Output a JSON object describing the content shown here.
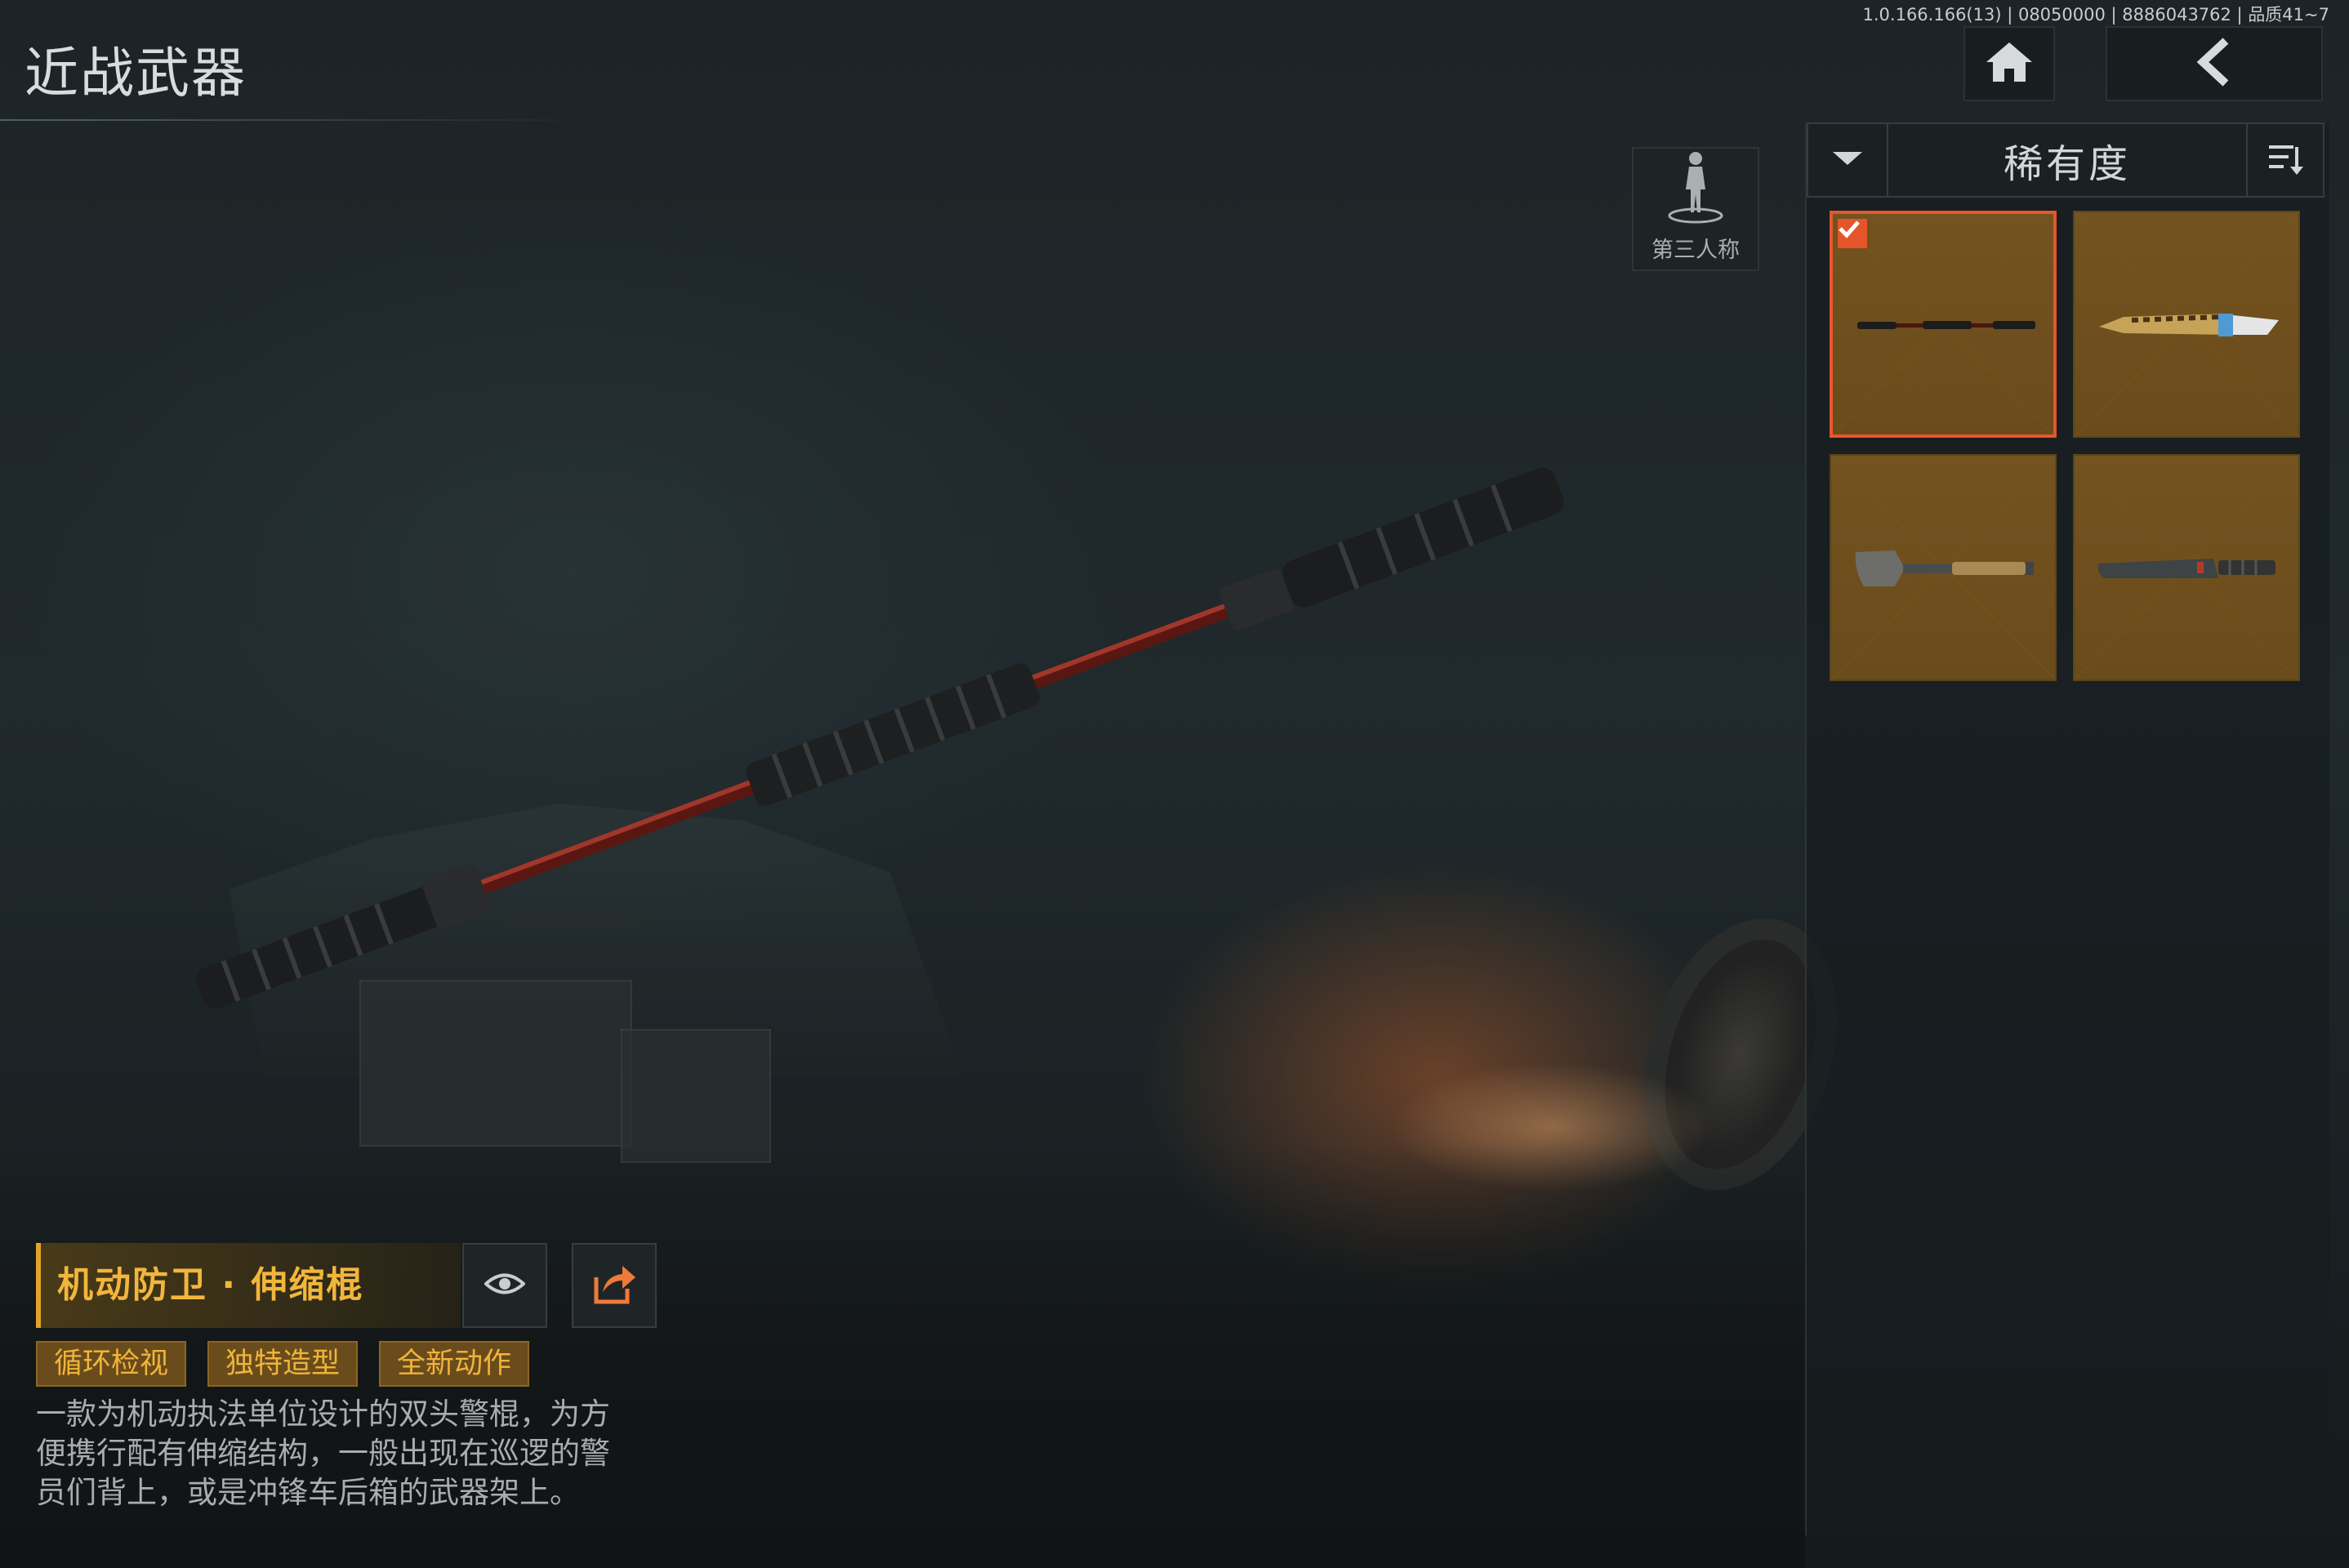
{
  "header": {
    "title": "近战武器",
    "version": "1.0.166.166(13) | 08050000 | 8886043762 | 品质41~7",
    "home_icon": "home-icon",
    "back_icon": "chevron-left-icon"
  },
  "view_toggle": {
    "label": "第三人称",
    "icon": "person-icon"
  },
  "sort": {
    "label": "稀有度",
    "dropdown_icon": "caret-down-icon",
    "order_icon": "sort-order-icon"
  },
  "items": [
    {
      "icon": "baton-icon",
      "selected": true
    },
    {
      "icon": "knife-icon",
      "selected": false
    },
    {
      "icon": "shovel-icon",
      "selected": false
    },
    {
      "icon": "machete-icon",
      "selected": false
    }
  ],
  "weapon": {
    "name": "机动防卫 · 伸缩棍",
    "preview_icon": "eye-icon",
    "share_icon": "share-icon",
    "tags": [
      "循环检视",
      "独特造型",
      "全新动作"
    ],
    "description_lines": [
      "一款为机动执法单位设计的双头警棍，为方",
      "便携行配有伸缩结构，一般出现在巡逻的警",
      "员们背上，或是冲锋车后箱的武器架上。"
    ]
  },
  "colors": {
    "accent": "#f2b63b",
    "selection": "#e5572b",
    "item_bg": "#6e4f1d"
  }
}
